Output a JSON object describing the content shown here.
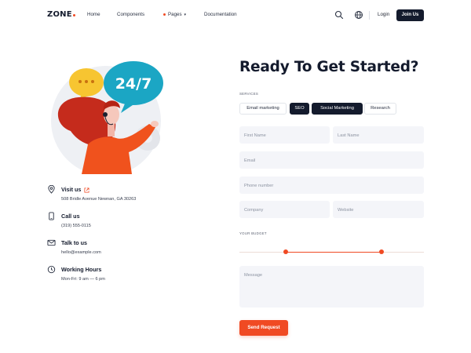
{
  "nav": {
    "logo": "ZONE",
    "links": [
      "Home",
      "Components",
      "Pages",
      "Documentation"
    ],
    "login": "Login",
    "join": "Join Us"
  },
  "illustration": {
    "badge_text": "24/7"
  },
  "contact": [
    {
      "title": "Visit us",
      "text": "508 Bridle Avenue Newnan, GA 30263",
      "icon": "map-pin-icon"
    },
    {
      "title": "Call us",
      "text": "(319) 555-0115",
      "icon": "phone-icon"
    },
    {
      "title": "Talk to us",
      "text": "hello@example.com",
      "icon": "mail-icon"
    },
    {
      "title": "Working Hours",
      "text": "Mon-Fri: 9 am — 6 pm",
      "icon": "clock-icon"
    }
  ],
  "form": {
    "heading": "Ready To Get Started?",
    "services_label": "SERVICES",
    "services": [
      "Email marketing",
      "SEO",
      "Social Marketing",
      "Research"
    ],
    "selected_services": [
      "SEO",
      "Social Marketing"
    ],
    "placeholders": {
      "first_name": "First Name",
      "last_name": "Last Name",
      "email": "Email",
      "phone": "Phone number",
      "company": "Company",
      "website": "Website",
      "message": "Message"
    },
    "budget_label": "YOUR BUDGET",
    "budget_range": [
      0.25,
      0.77
    ],
    "submit": "Send Request"
  },
  "colors": {
    "accent": "#f04a23",
    "dark": "#141b2d",
    "field_bg": "#f4f5f9"
  }
}
